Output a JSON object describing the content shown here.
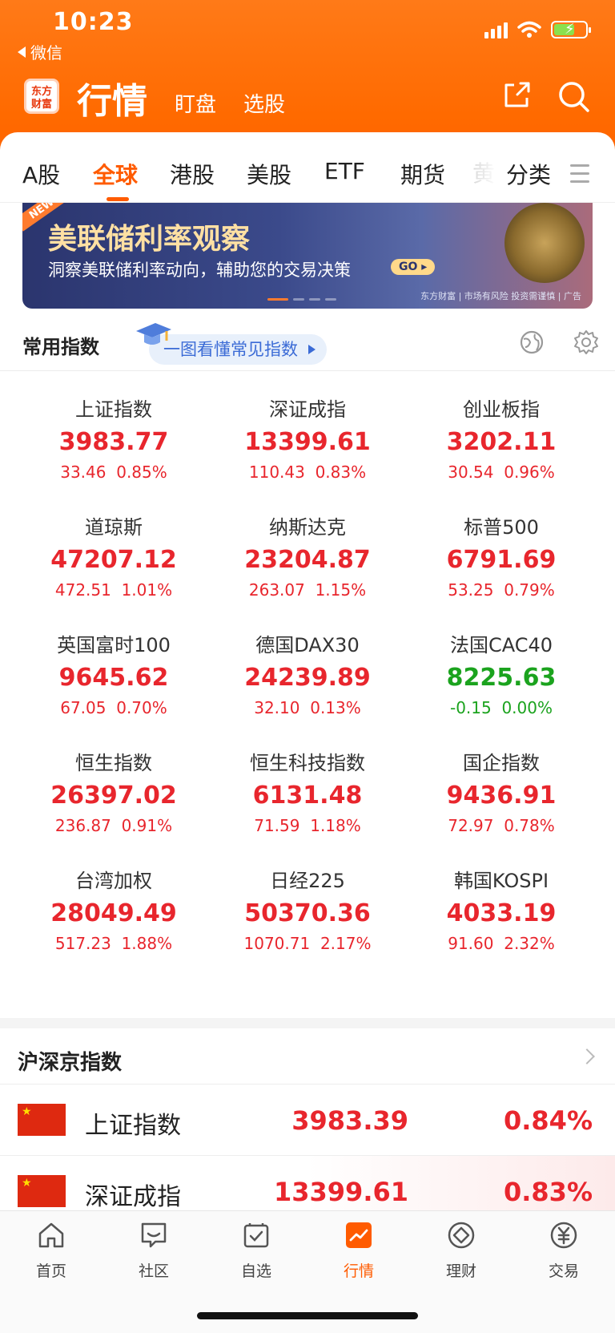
{
  "status_bar": {
    "time": "10:23",
    "back_app": "微信"
  },
  "header": {
    "logo_text": "东方财富",
    "title": "行情",
    "tabs": [
      "盯盘",
      "选股"
    ]
  },
  "market_tabs": {
    "items": [
      "A股",
      "全球",
      "港股",
      "美股",
      "ETF",
      "期货"
    ],
    "faded": "黄",
    "active": "全球",
    "category_label": "分类"
  },
  "banner": {
    "badge": "NEW",
    "title": "美联储利率观察",
    "subtitle": "洞察美联储利率动向，辅助您的交易决策",
    "go_label": "GO",
    "footer": "东方财富 | 市场有风险 投资需谨慎 | 广告"
  },
  "common_indices": {
    "title": "常用指数",
    "guide_label": "一图看懂常见指数",
    "items": [
      {
        "name": "上证指数",
        "price": "3983.77",
        "change": "33.46",
        "pct": "0.85%",
        "dir": "up"
      },
      {
        "name": "深证成指",
        "price": "13399.61",
        "change": "110.43",
        "pct": "0.83%",
        "dir": "up"
      },
      {
        "name": "创业板指",
        "price": "3202.11",
        "change": "30.54",
        "pct": "0.96%",
        "dir": "up"
      },
      {
        "name": "道琼斯",
        "price": "47207.12",
        "change": "472.51",
        "pct": "1.01%",
        "dir": "up"
      },
      {
        "name": "纳斯达克",
        "price": "23204.87",
        "change": "263.07",
        "pct": "1.15%",
        "dir": "up"
      },
      {
        "name": "标普500",
        "price": "6791.69",
        "change": "53.25",
        "pct": "0.79%",
        "dir": "up"
      },
      {
        "name": "英国富时100",
        "price": "9645.62",
        "change": "67.05",
        "pct": "0.70%",
        "dir": "up"
      },
      {
        "name": "德国DAX30",
        "price": "24239.89",
        "change": "32.10",
        "pct": "0.13%",
        "dir": "up"
      },
      {
        "name": "法国CAC40",
        "price": "8225.63",
        "change": "-0.15",
        "pct": "0.00%",
        "dir": "down"
      },
      {
        "name": "恒生指数",
        "price": "26397.02",
        "change": "236.87",
        "pct": "0.91%",
        "dir": "up"
      },
      {
        "name": "恒生科技指数",
        "price": "6131.48",
        "change": "71.59",
        "pct": "1.18%",
        "dir": "up"
      },
      {
        "name": "国企指数",
        "price": "9436.91",
        "change": "72.97",
        "pct": "0.78%",
        "dir": "up"
      },
      {
        "name": "台湾加权",
        "price": "28049.49",
        "change": "517.23",
        "pct": "1.88%",
        "dir": "up"
      },
      {
        "name": "日经225",
        "price": "50370.36",
        "change": "1070.71",
        "pct": "2.17%",
        "dir": "up"
      },
      {
        "name": "韩国KOSPI",
        "price": "4033.19",
        "change": "91.60",
        "pct": "2.32%",
        "dir": "up"
      }
    ]
  },
  "hsj_indices": {
    "title": "沪深京指数",
    "rows": [
      {
        "name": "上证指数",
        "price": "3983.39",
        "pct": "0.84%"
      },
      {
        "name": "深证成指",
        "price": "13399.61",
        "pct": "0.83%"
      }
    ]
  },
  "bottom_nav": {
    "items": [
      {
        "label": "首页",
        "icon": "home-icon"
      },
      {
        "label": "社区",
        "icon": "community-icon"
      },
      {
        "label": "自选",
        "icon": "watchlist-icon"
      },
      {
        "label": "行情",
        "icon": "market-icon"
      },
      {
        "label": "理财",
        "icon": "wealth-icon"
      },
      {
        "label": "交易",
        "icon": "trade-icon"
      }
    ],
    "active": "行情"
  },
  "colors": {
    "brand_orange": "#ff5b00",
    "up_red": "#e8262d",
    "down_green": "#1ba31e"
  }
}
